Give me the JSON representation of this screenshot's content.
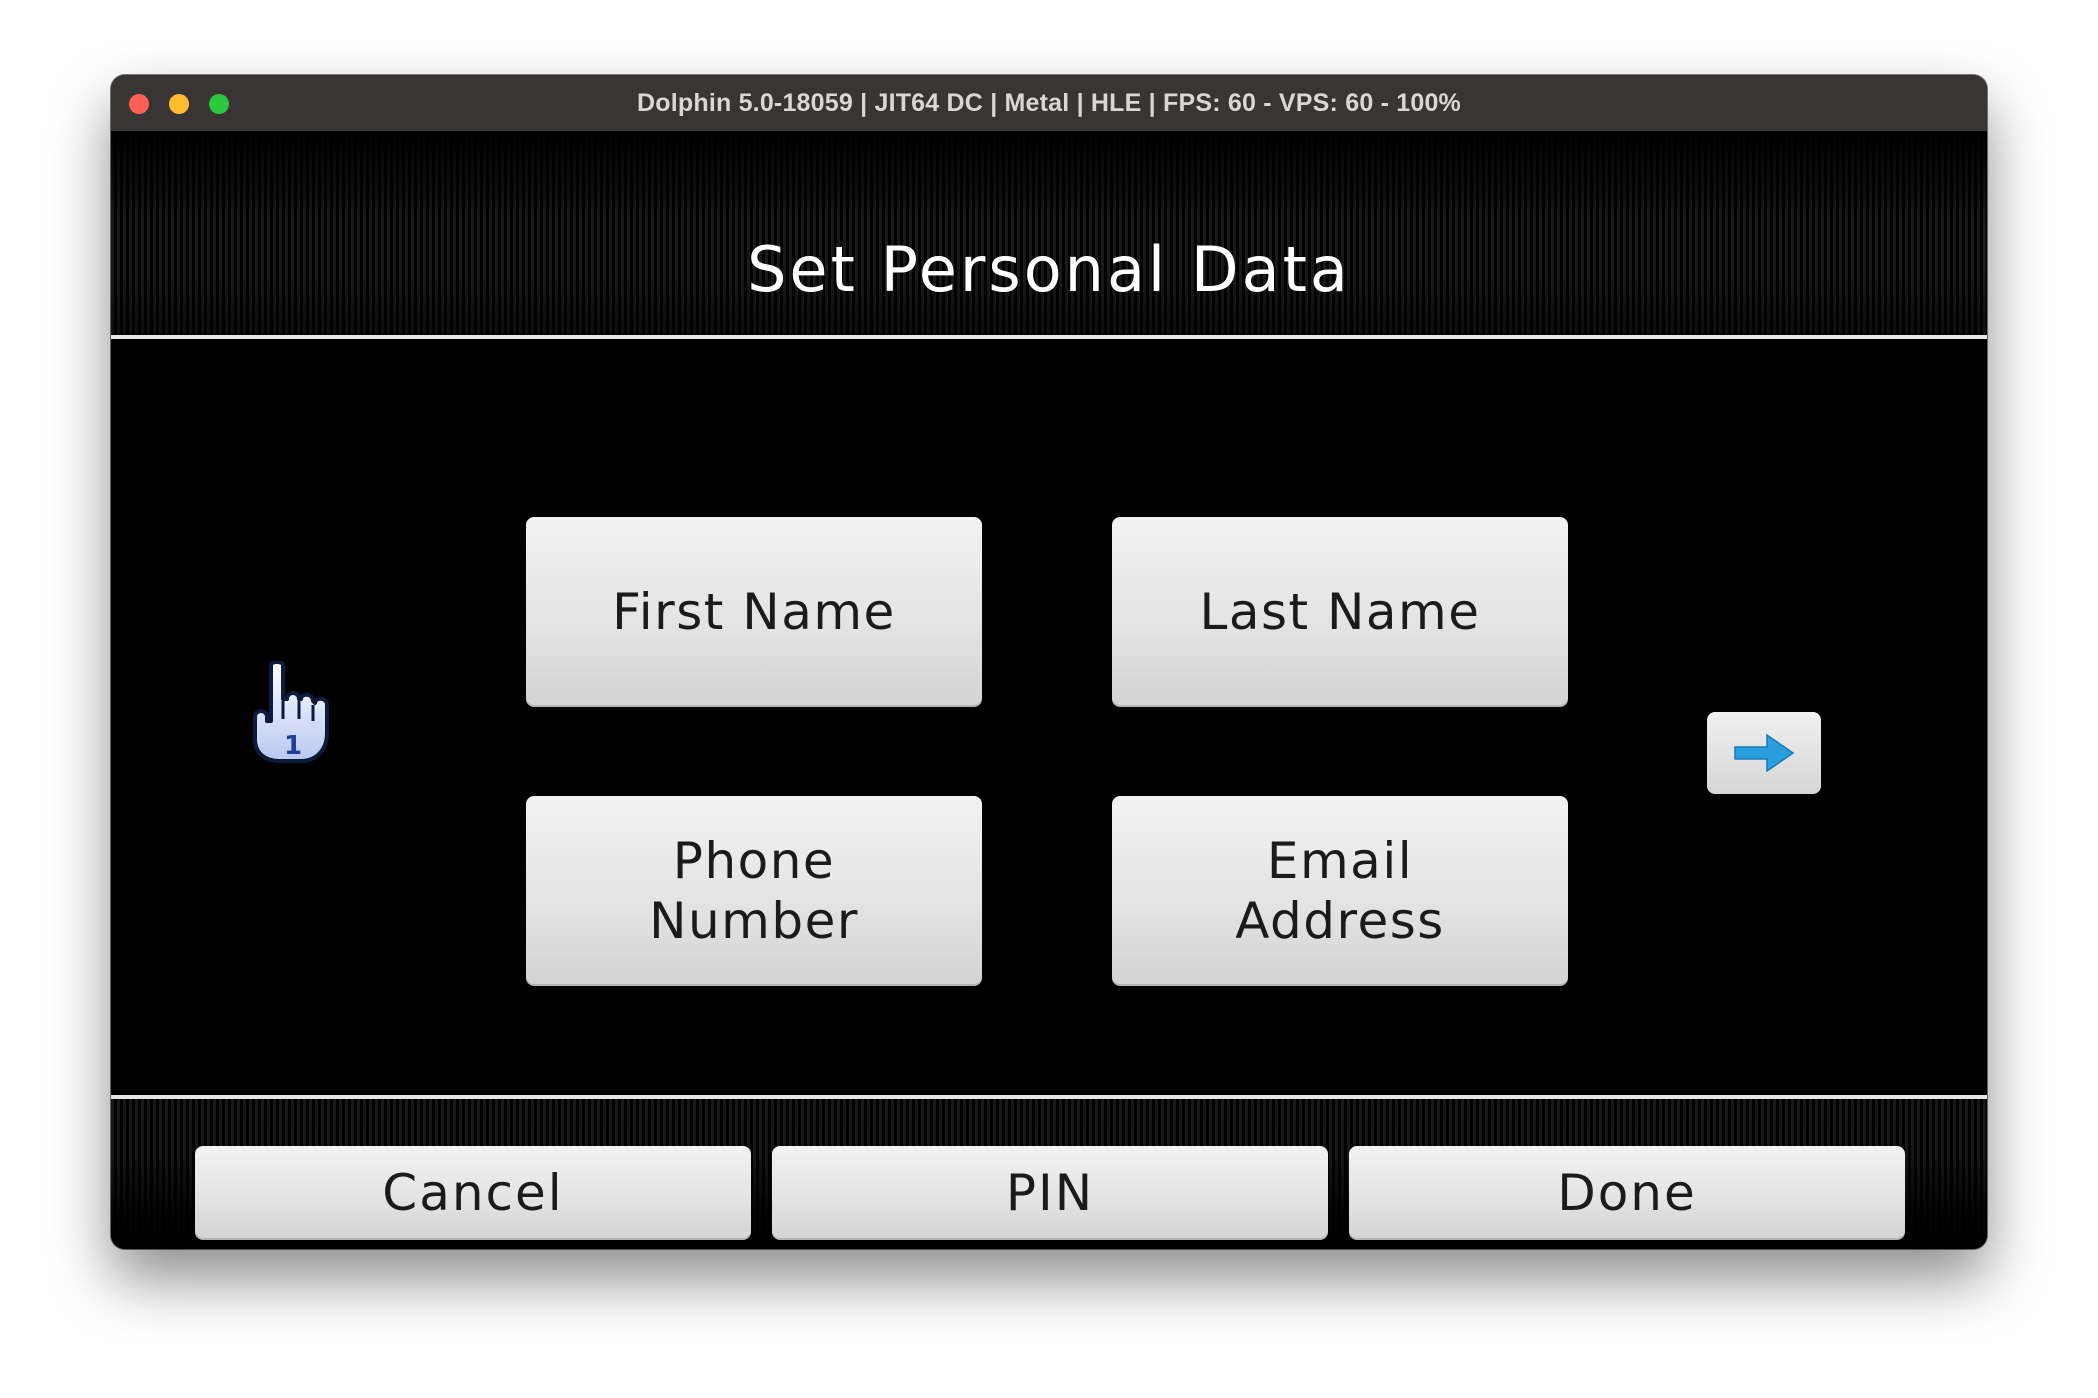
{
  "window": {
    "title": "Dolphin 5.0-18059 | JIT64 DC | Metal | HLE | FPS: 60 - VPS: 60 - 100%"
  },
  "screen": {
    "title": "Set Personal Data"
  },
  "fields": {
    "first_name": "First Name",
    "last_name": "Last Name",
    "phone_number": "Phone\nNumber",
    "email_address": "Email\nAddress"
  },
  "cursor": {
    "player_number": "1",
    "icon": "pointing-hand-icon"
  },
  "next_button": {
    "icon": "arrow-right-icon",
    "color": "#2a9fe0"
  },
  "footer": {
    "cancel_label": "Cancel",
    "pin_label": "PIN",
    "done_label": "Done"
  },
  "colors": {
    "titlebar": "#3a3535",
    "close": "#fe5f57",
    "minimize": "#febc2e",
    "maximize": "#28c840",
    "background": "#000000",
    "button": "#e4e4e4"
  }
}
